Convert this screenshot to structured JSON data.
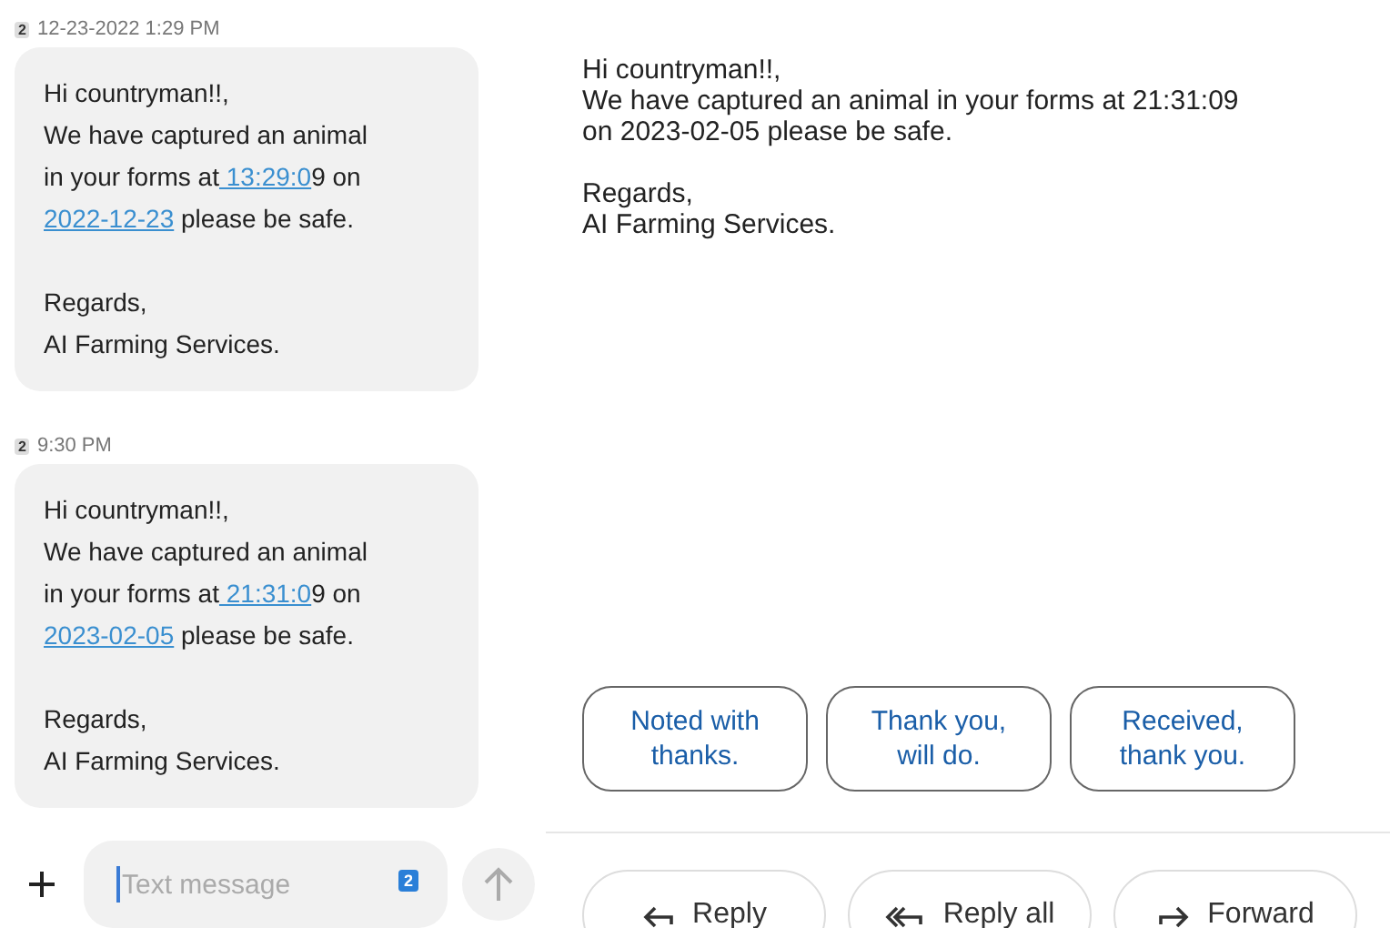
{
  "conversation": {
    "messages": [
      {
        "sim": "2",
        "time": "12-23-2022 1:29 PM",
        "body": [
          {
            "text": "Hi countryman!!,\nWe have captured an animal\nin your forms at",
            "link": false
          },
          {
            "text": " 13:29:0",
            "link": true
          },
          {
            "text": "9 on\n",
            "link": false
          },
          {
            "text": "2022-12-23",
            "link": true
          },
          {
            "text": " please be safe.\n\nRegards,\nAI Farming Services.",
            "link": false
          }
        ]
      },
      {
        "sim": "2",
        "time": "9:30 PM",
        "body": [
          {
            "text": "Hi countryman!!,\nWe have captured an animal\nin your forms at",
            "link": false
          },
          {
            "text": " 21:31:0",
            "link": true
          },
          {
            "text": "9 on\n",
            "link": false
          },
          {
            "text": "2023-02-05",
            "link": true
          },
          {
            "text": " please be safe.\n\nRegards,\nAI Farming Services.",
            "link": false
          }
        ]
      }
    ],
    "composer": {
      "placeholder": "Text message",
      "sim": "2"
    }
  },
  "email": {
    "body": "Hi countryman!!,\nWe have captured an animal in your forms at 21:31:09\non 2023-02-05 please be safe.\n\nRegards,\nAI Farming Services.",
    "smart_replies": [
      "Noted with\nthanks.",
      "Thank you,\nwill do.",
      "Received,\nthank you."
    ],
    "actions": [
      {
        "kind": "reply",
        "label": "Reply"
      },
      {
        "kind": "reply_all",
        "label": "Reply all"
      },
      {
        "kind": "forward",
        "label": "Forward"
      }
    ]
  }
}
